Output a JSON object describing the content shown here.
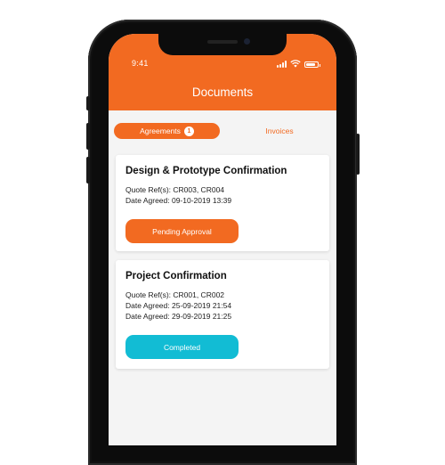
{
  "status_bar": {
    "time": "9:41",
    "battery_level": 0.8
  },
  "header": {
    "title": "Documents"
  },
  "tabs": [
    {
      "label": "Agreements",
      "badge": "1",
      "active": true
    },
    {
      "label": "Invoices",
      "active": false
    }
  ],
  "agreements": [
    {
      "title": "Design & Prototype Confirmation",
      "lines": [
        "Quote Ref(s): CR003, CR004",
        "Date Agreed: 09-10-2019 13:39"
      ],
      "status": "Pending Approval"
    },
    {
      "title": "Project Confirmation",
      "lines": [
        "Quote Ref(s): CR001, CR002",
        "Date Agreed: 25-09-2019 21:54",
        "Date Agreed: 29-09-2019 21:25"
      ],
      "status": "Completed"
    }
  ],
  "colors": {
    "brand": "#f26a21",
    "completed": "#12bcd4",
    "background": "#f4f4f4"
  }
}
